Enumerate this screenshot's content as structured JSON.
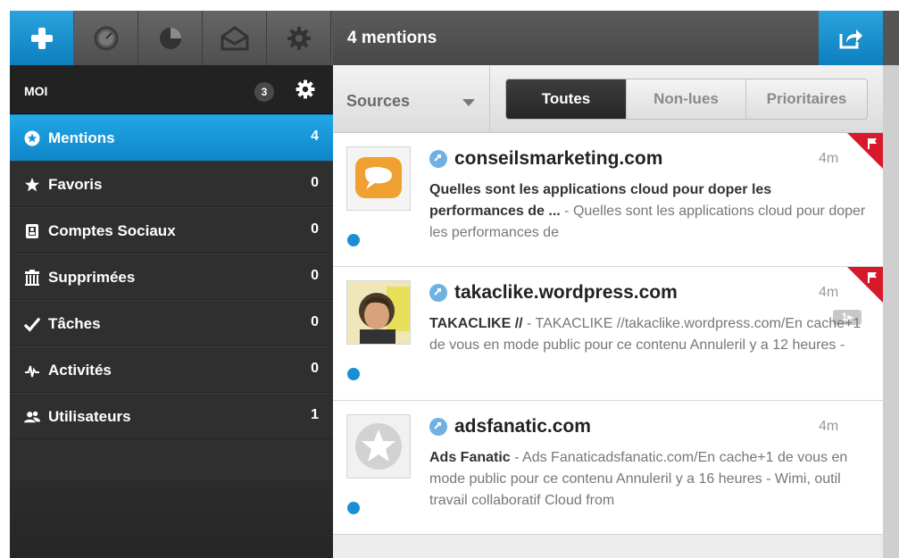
{
  "toolbar": {
    "title": "4 mentions",
    "buttons": [
      "add-icon",
      "dashboard-icon",
      "pie-chart-icon",
      "mail-icon",
      "gear-icon"
    ],
    "share_icon": "share-icon"
  },
  "sidebar": {
    "header": "MOI",
    "header_count": "3",
    "items": [
      {
        "label": "Mentions",
        "count": "4",
        "icon": "star-circle-icon"
      },
      {
        "label": "Favoris",
        "count": "0",
        "icon": "star-icon"
      },
      {
        "label": "Comptes Sociaux",
        "count": "0",
        "icon": "contact-book-icon"
      },
      {
        "label": "Supprimées",
        "count": "0",
        "icon": "trash-icon"
      },
      {
        "label": "Tâches",
        "count": "0",
        "icon": "check-icon"
      },
      {
        "label": "Activités",
        "count": "0",
        "icon": "activity-icon"
      },
      {
        "label": "Utilisateurs",
        "count": "1",
        "icon": "users-icon"
      }
    ]
  },
  "filters": {
    "sources_label": "Sources",
    "tabs": [
      "Toutes",
      "Non-lues",
      "Prioritaires"
    ],
    "active_tab": "Toutes"
  },
  "mentions": [
    {
      "site": "conseilsmarketing.com",
      "time": "4m",
      "title": "Quelles sont les applications cloud pour doper les performances de ...",
      "excerpt": " - Quelles sont les applications cloud pour doper les performances de",
      "flagged": true
    },
    {
      "site": "takaclike.wordpress.com",
      "time": "4m",
      "title": "TAKACLIKE //",
      "excerpt": " - TAKACLIKE //takaclike.wordpress.com/En cache+1 de vous en mode public pour ce contenu Annuleril y a 12 heures -",
      "badge": "1▸",
      "flagged": true
    },
    {
      "site": "adsfanatic.com",
      "time": "4m",
      "title": "Ads Fanatic",
      "excerpt": " - Ads Fanaticadsfanatic.com/En cache+1 de vous en mode public pour ce contenu Annuleril y a 16 heures - Wimi, outil travail collaboratif Cloud from",
      "flagged": false
    }
  ],
  "colors": {
    "accent": "#1b8fd6",
    "flag": "#d8192b"
  }
}
